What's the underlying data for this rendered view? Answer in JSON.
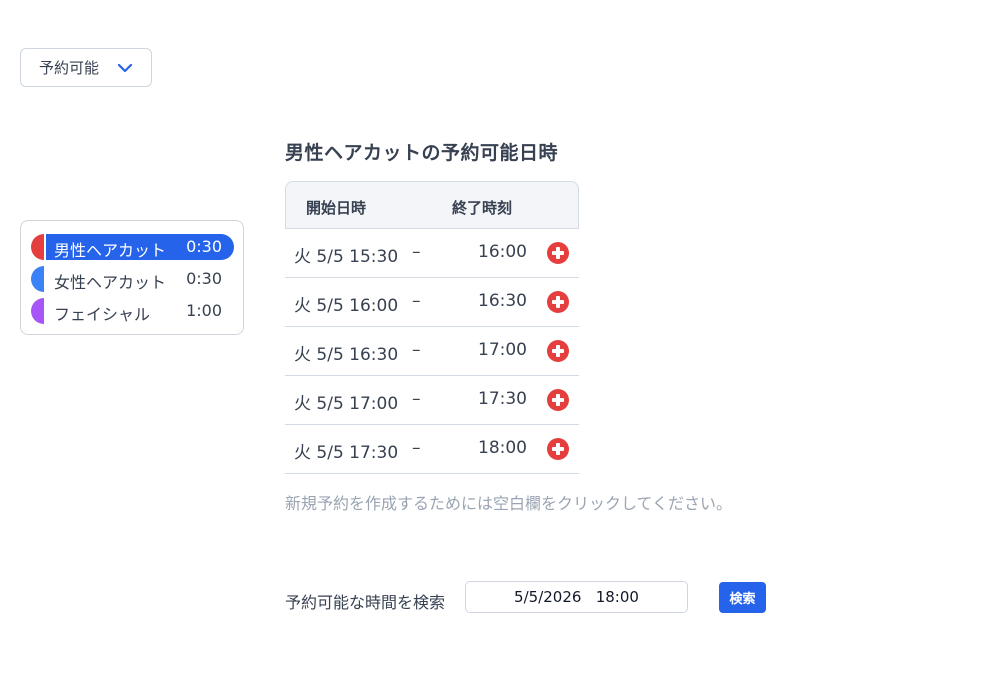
{
  "filter": {
    "selected": "予約可能",
    "icon": "chevron-down-icon"
  },
  "services": [
    {
      "name": "男性ヘアカット",
      "duration": "0:30",
      "color": "#e53e3e",
      "selected": true
    },
    {
      "name": "女性ヘアカット",
      "duration": "0:30",
      "color": "#3b82f6",
      "selected": false
    },
    {
      "name": "フェイシャル",
      "duration": "1:00",
      "color": "#a855f7",
      "selected": false
    }
  ],
  "availability": {
    "title": "男性ヘアカットの予約可能日時",
    "columns": {
      "start": "開始日時",
      "end": "終了時刻"
    },
    "rows": [
      {
        "start": "火 5/5 15:30",
        "dash": "–",
        "end": "16:00"
      },
      {
        "start": "火 5/5 16:00",
        "dash": "–",
        "end": "16:30"
      },
      {
        "start": "火 5/5 16:30",
        "dash": "–",
        "end": "17:00"
      },
      {
        "start": "火 5/5 17:00",
        "dash": "–",
        "end": "17:30"
      },
      {
        "start": "火 5/5 17:30",
        "dash": "–",
        "end": "18:00"
      }
    ],
    "hint": "新規予約を作成するためには空白欄をクリックしてください。"
  },
  "search": {
    "label": "予約可能な時間を検索",
    "value": "5/5/2026   18:00",
    "button": "検索"
  },
  "colors": {
    "accent": "#2563eb",
    "add_button": "#e53e3e"
  }
}
